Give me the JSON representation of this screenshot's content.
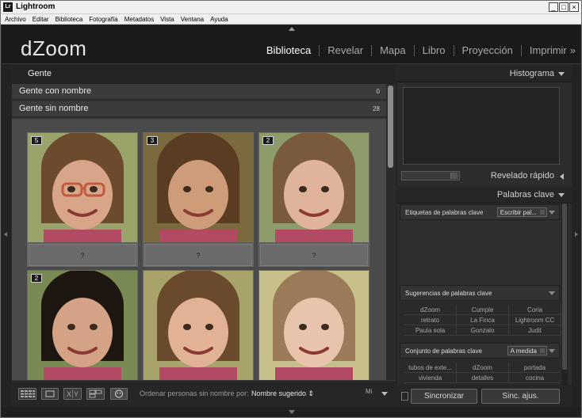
{
  "window": {
    "title": "Lightroom",
    "logo_text": "Lr",
    "controls": [
      "_",
      "□",
      "×"
    ]
  },
  "menu": [
    "Archivo",
    "Editar",
    "Biblioteca",
    "Fotografía",
    "Metadatos",
    "Vista",
    "Ventana",
    "Ayuda"
  ],
  "identity_plate": "dZoom",
  "modules": [
    {
      "label": "Biblioteca",
      "active": true
    },
    {
      "label": "Revelar",
      "active": false
    },
    {
      "label": "Mapa",
      "active": false
    },
    {
      "label": "Libro",
      "active": false
    },
    {
      "label": "Proyección",
      "active": false
    },
    {
      "label": "Imprimir",
      "active": false
    }
  ],
  "modules_more": "»",
  "people": {
    "tab": "Gente",
    "groups": [
      {
        "label": "Gente con nombre",
        "count": "0"
      },
      {
        "label": "Gente sin nombre",
        "count": "28"
      }
    ],
    "cells": [
      {
        "badge": "5",
        "name_placeholder": "?",
        "skin": "#d9a589",
        "hair": "#6b4a2e",
        "bg": "#9aa36a",
        "glasses": true
      },
      {
        "badge": "3",
        "name_placeholder": "?",
        "skin": "#cf9c79",
        "hair": "#5a3c22",
        "bg": "#7b6a3e",
        "glasses": false
      },
      {
        "badge": "2",
        "name_placeholder": "?",
        "skin": "#e0b49b",
        "hair": "#7a5a3c",
        "bg": "#8e9b6a",
        "glasses": false
      },
      {
        "badge": "2",
        "name_placeholder": "",
        "skin": "#d4a386",
        "hair": "#1e1610",
        "bg": "#7a8a55",
        "glasses": false
      },
      {
        "badge": "",
        "name_placeholder": "",
        "skin": "#e1b294",
        "hair": "#6a4a2c",
        "bg": "#a8a36a",
        "glasses": false
      },
      {
        "badge": "",
        "name_placeholder": "",
        "skin": "#e9c4ac",
        "hair": "#9a7a58",
        "bg": "#c7c08a",
        "glasses": false
      }
    ]
  },
  "toolbar": {
    "sort_label": "Ordenar personas sin nombre por:",
    "sort_value": "Nombre sugerido ⇕",
    "extra": "Mi"
  },
  "right_panel": {
    "histograma": "Histograma",
    "revelado_rapido": "Revelado rápido",
    "palabras_clave": "Palabras clave",
    "etiquetas": "Etiquetas de palabras clave",
    "etiquetas_select": "Escribir pal...",
    "sugerencias": "Sugerencias de palabras clave",
    "suggestions": [
      "dZoom",
      "Cumple",
      "Coria",
      "retrato",
      "La Finca",
      "Lightroom CC",
      "Paula sola",
      "Gonzalo",
      "Judit"
    ],
    "conjunto": "Conjunto de palabras clave",
    "conjunto_select": "A medida",
    "set_keywords": [
      "tubos de exte...",
      "dZoom",
      "portada",
      "vivienda",
      "detalles",
      "cocina"
    ],
    "sync_button": "Sincronizar",
    "sync_settings_button": "Sinc. ajus."
  }
}
